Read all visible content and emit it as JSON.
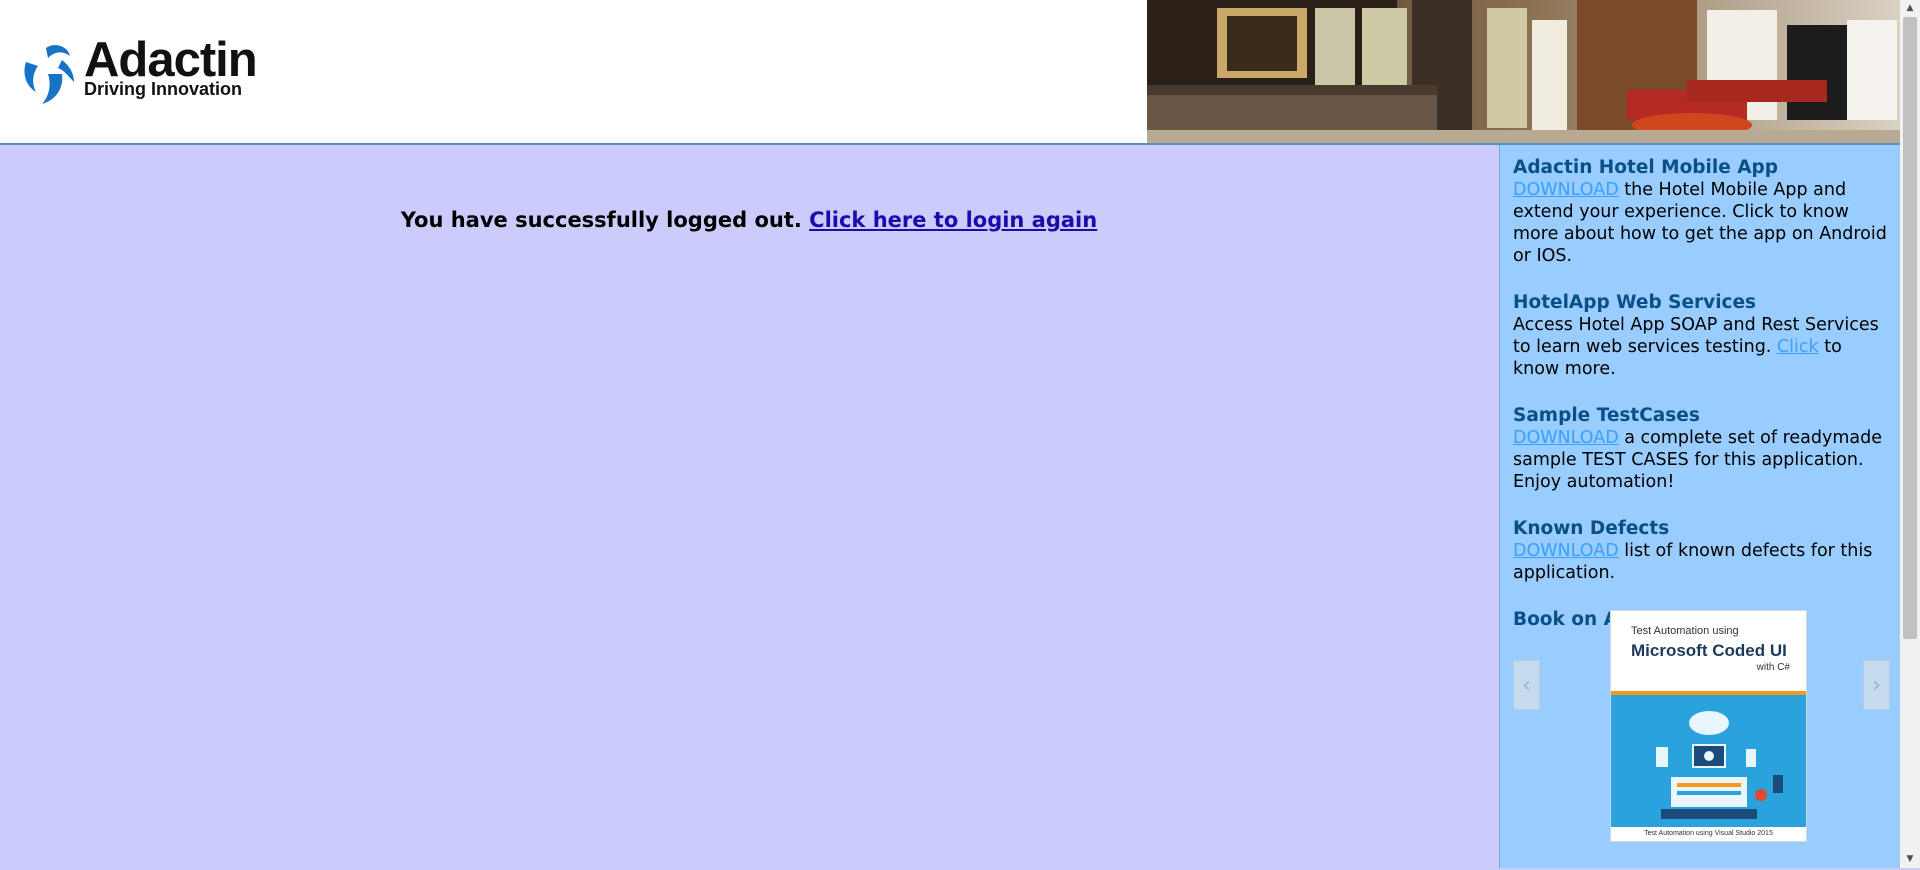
{
  "header": {
    "logo_name": "Adactin",
    "logo_tagline": "Driving Innovation"
  },
  "main": {
    "logout_text": "You have successfully logged out.",
    "login_again_link": "Click here to login again"
  },
  "sidebar": {
    "mobile_app": {
      "title": "Adactin Hotel Mobile App",
      "link": "DOWNLOAD",
      "text": " the Hotel Mobile App and extend your experience. Click to know more about how to get the app on Android or IOS."
    },
    "web_services": {
      "title": "HotelApp Web Services",
      "text_before": "Access Hotel App SOAP and Rest Services to learn web services testing. ",
      "link": "Click",
      "text_after": " to know more."
    },
    "test_cases": {
      "title": "Sample TestCases",
      "link": "DOWNLOAD",
      "text": " a complete set of readymade sample TEST CASES for this application. Enjoy automation!"
    },
    "known_defects": {
      "title": "Known Defects",
      "link": "DOWNLOAD",
      "text": " list of known defects for this application."
    },
    "book": {
      "title": "Book on Automation",
      "cover_line1": "Test Automation using",
      "cover_line2": "Microsoft Coded UI",
      "cover_line3": "with C#",
      "cover_footer": "Test Automation using Visual Studio 2015"
    }
  },
  "icons": {
    "prev": "chevron-left-icon",
    "next": "chevron-right-icon"
  },
  "colors": {
    "main_bg": "#ccccfc",
    "sidebar_bg": "#99ccff",
    "sidebar_title": "#0a4f86",
    "sidebar_link": "#3aa0ff",
    "main_link": "#1a0dab"
  }
}
